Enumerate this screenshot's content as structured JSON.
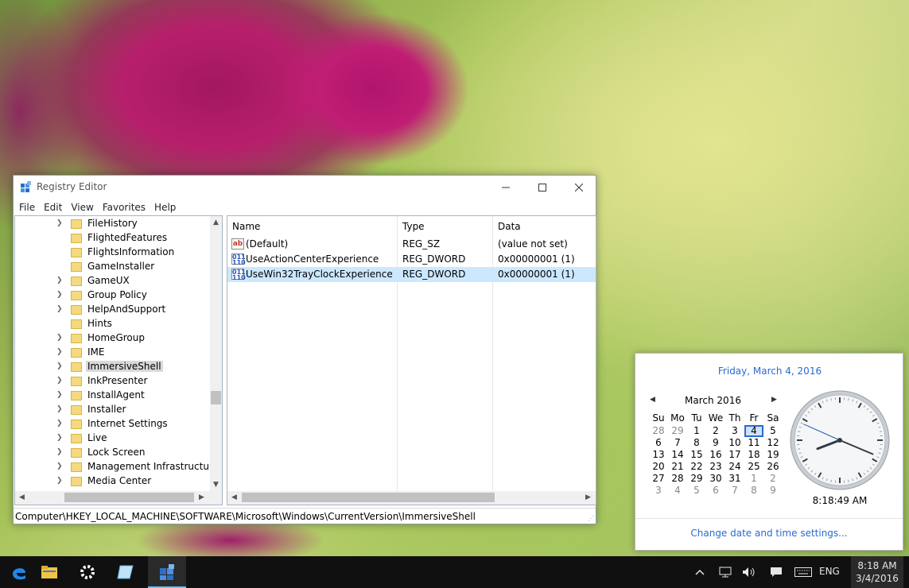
{
  "window": {
    "title": "Registry Editor",
    "menu": [
      "File",
      "Edit",
      "View",
      "Favorites",
      "Help"
    ]
  },
  "tree": {
    "items": [
      {
        "label": "FileHistory",
        "expandable": true
      },
      {
        "label": "FlightedFeatures",
        "expandable": false
      },
      {
        "label": "FlightsInformation",
        "expandable": false
      },
      {
        "label": "GameInstaller",
        "expandable": false
      },
      {
        "label": "GameUX",
        "expandable": true
      },
      {
        "label": "Group Policy",
        "expandable": true
      },
      {
        "label": "HelpAndSupport",
        "expandable": true
      },
      {
        "label": "Hints",
        "expandable": false
      },
      {
        "label": "HomeGroup",
        "expandable": true
      },
      {
        "label": "IME",
        "expandable": true
      },
      {
        "label": "ImmersiveShell",
        "expandable": true,
        "selected": true
      },
      {
        "label": "InkPresenter",
        "expandable": true
      },
      {
        "label": "InstallAgent",
        "expandable": true
      },
      {
        "label": "Installer",
        "expandable": true
      },
      {
        "label": "Internet Settings",
        "expandable": true
      },
      {
        "label": "Live",
        "expandable": true
      },
      {
        "label": "Lock Screen",
        "expandable": true
      },
      {
        "label": "Management Infrastructure",
        "expandable": true
      },
      {
        "label": "Media Center",
        "expandable": true
      }
    ]
  },
  "list": {
    "columns": [
      "Name",
      "Type",
      "Data"
    ],
    "rows": [
      {
        "name": "(Default)",
        "type": "REG_SZ",
        "data": "(value not set)",
        "icon": "string-value-icon"
      },
      {
        "name": "UseActionCenterExperience",
        "type": "REG_DWORD",
        "data": "0x00000001 (1)",
        "icon": "dword-value-icon"
      },
      {
        "name": "UseWin32TrayClockExperience",
        "type": "REG_DWORD",
        "data": "0x00000001 (1)",
        "icon": "dword-value-icon",
        "selected": true
      }
    ]
  },
  "status": {
    "path": "Computer\\HKEY_LOCAL_MACHINE\\SOFTWARE\\Microsoft\\Windows\\CurrentVersion\\ImmersiveShell"
  },
  "flyout": {
    "long_date": "Friday, March 4, 2016",
    "month_label": "March 2016",
    "weekdays": [
      "Su",
      "Mo",
      "Tu",
      "We",
      "Th",
      "Fr",
      "Sa"
    ],
    "weeks": [
      [
        {
          "d": "28",
          "o": true
        },
        {
          "d": "29",
          "o": true
        },
        {
          "d": "1"
        },
        {
          "d": "2"
        },
        {
          "d": "3"
        },
        {
          "d": "4",
          "t": true
        },
        {
          "d": "5"
        }
      ],
      [
        {
          "d": "6"
        },
        {
          "d": "7"
        },
        {
          "d": "8"
        },
        {
          "d": "9"
        },
        {
          "d": "10"
        },
        {
          "d": "11"
        },
        {
          "d": "12"
        }
      ],
      [
        {
          "d": "13"
        },
        {
          "d": "14"
        },
        {
          "d": "15"
        },
        {
          "d": "16"
        },
        {
          "d": "17"
        },
        {
          "d": "18"
        },
        {
          "d": "19"
        }
      ],
      [
        {
          "d": "20"
        },
        {
          "d": "21"
        },
        {
          "d": "22"
        },
        {
          "d": "23"
        },
        {
          "d": "24"
        },
        {
          "d": "25"
        },
        {
          "d": "26"
        }
      ],
      [
        {
          "d": "27"
        },
        {
          "d": "28"
        },
        {
          "d": "29"
        },
        {
          "d": "30"
        },
        {
          "d": "31"
        },
        {
          "d": "1",
          "o": true
        },
        {
          "d": "2",
          "o": true
        }
      ],
      [
        {
          "d": "3",
          "o": true
        },
        {
          "d": "4",
          "o": true
        },
        {
          "d": "5",
          "o": true
        },
        {
          "d": "6",
          "o": true
        },
        {
          "d": "7",
          "o": true
        },
        {
          "d": "8",
          "o": true
        },
        {
          "d": "9",
          "o": true
        }
      ]
    ],
    "time_text": "8:18:49 AM",
    "clock": {
      "hour": 8,
      "minute": 18,
      "second": 49
    },
    "settings_link": "Change date and time settings..."
  },
  "taskbar": {
    "apps": [
      "edge-icon",
      "file-explorer-icon",
      "settings-icon",
      "notepad-icon",
      "regedit-icon"
    ],
    "language": "ENG",
    "time": "8:18 AM",
    "date": "3/4/2016"
  },
  "colors": {
    "accent_link": "#2a6ad1",
    "selection": "#cce8ff",
    "taskbar": "#101010"
  }
}
